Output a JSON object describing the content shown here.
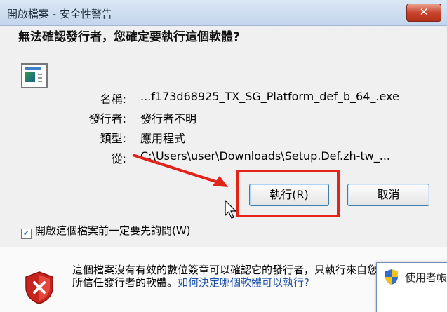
{
  "titlebar": {
    "title": "開啟檔案 - 安全性警告",
    "close_label": "✕"
  },
  "question": "無法確認發行者，您確定要執行這個軟體?",
  "fields": [
    {
      "label": "名稱:",
      "value": "...f173d68925_TX_SG_Platform_def_b_64_.exe"
    },
    {
      "label": "發行者:",
      "value": "發行者不明"
    },
    {
      "label": "類型:",
      "value": "應用程式"
    },
    {
      "label": "從:",
      "value": "C:\\Users\\user\\Downloads\\Setup.Def.zh-tw_..."
    }
  ],
  "buttons": {
    "run_label": "執行(R)",
    "cancel_label": "取消"
  },
  "checkbox": {
    "label": "開啟這個檔案前一定要先詢問(W)",
    "checked": true
  },
  "warning": {
    "text": "這個檔案沒有有效的數位簽章可以確認它的發行者，只執行來自您所信任發行者的軟體。",
    "link": "如何決定哪個軟體可以執行?"
  },
  "popup": {
    "text": "使用者帳戶控制"
  },
  "colors": {
    "highlight": "#e2231a",
    "link": "#1a4fa8",
    "shield_red": "#c8231d"
  },
  "icons": {
    "app": "application-icon",
    "shield": "shield-error-icon",
    "popup": "uac-shield-icon"
  }
}
